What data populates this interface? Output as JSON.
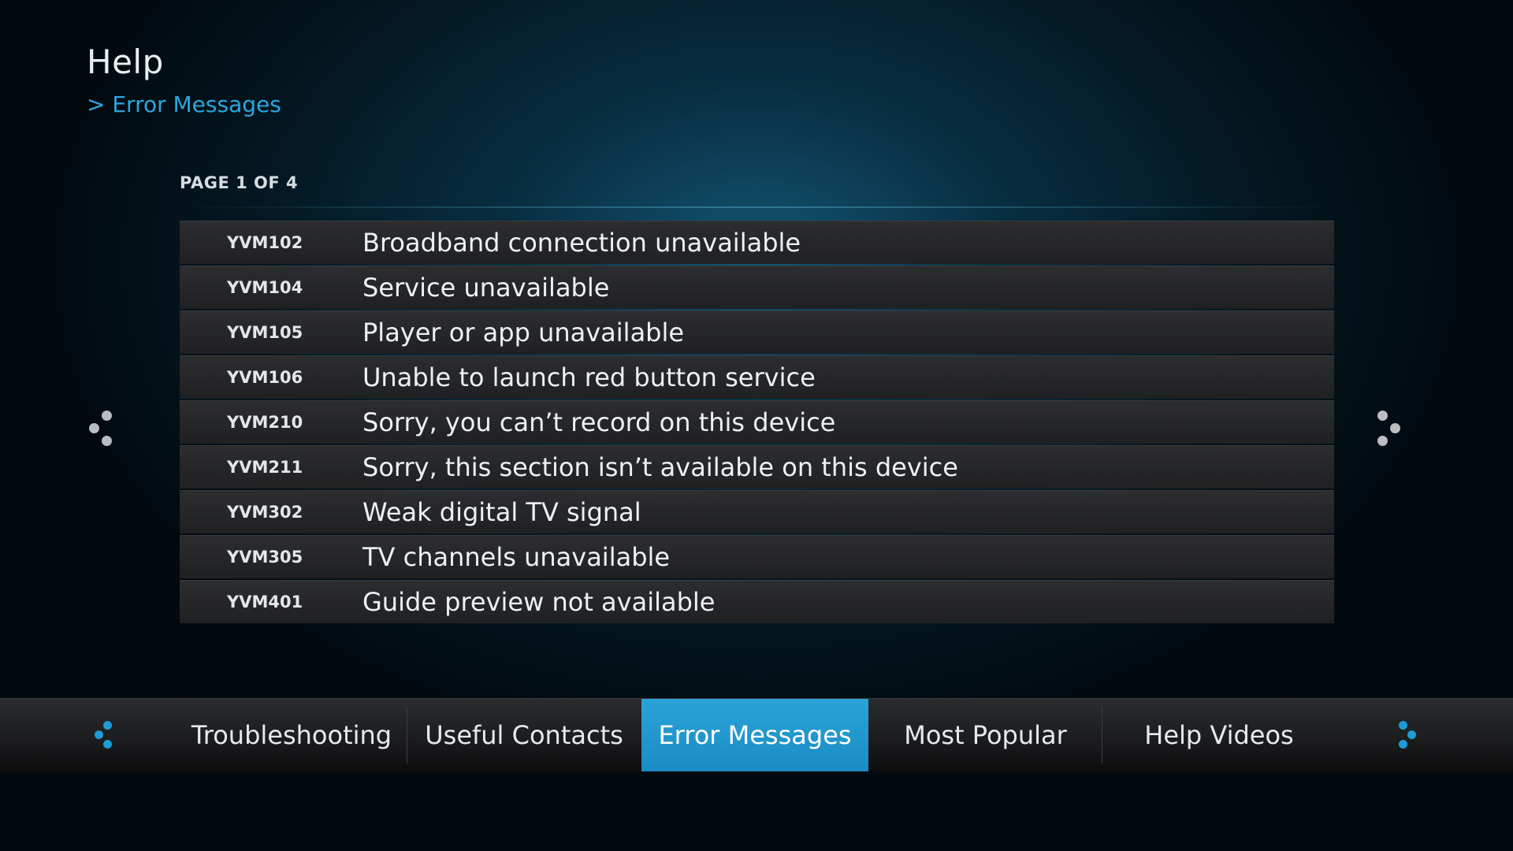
{
  "header": {
    "title": "Help",
    "breadcrumb": "> Error Messages"
  },
  "list": {
    "page_indicator": "PAGE 1 OF 4",
    "items": [
      {
        "code": "YVM102",
        "text": "Broadband connection unavailable"
      },
      {
        "code": "YVM104",
        "text": "Service unavailable"
      },
      {
        "code": "YVM105",
        "text": "Player or app unavailable"
      },
      {
        "code": "YVM106",
        "text": "Unable to launch red button service"
      },
      {
        "code": "YVM210",
        "text": "Sorry, you can’t record on this device"
      },
      {
        "code": "YVM211",
        "text": "Sorry, this section isn’t available on this device"
      },
      {
        "code": "YVM302",
        "text": "Weak digital TV signal"
      },
      {
        "code": "YVM305",
        "text": "TV channels unavailable"
      },
      {
        "code": "YVM401",
        "text": "Guide preview not available"
      }
    ]
  },
  "nav": {
    "tabs": [
      {
        "label": "Troubleshooting",
        "active": false
      },
      {
        "label": "Useful Contacts",
        "active": false
      },
      {
        "label": "Error Messages",
        "active": true
      },
      {
        "label": "Most Popular",
        "active": false
      },
      {
        "label": "Help Videos",
        "active": false
      }
    ]
  },
  "icons": {
    "list_prev": "page-prev-dots-icon",
    "list_next": "page-next-dots-icon",
    "nav_prev": "nav-prev-dots-icon",
    "nav_next": "nav-next-dots-icon"
  },
  "colors": {
    "accent": "#1e9bd6",
    "breadcrumb": "#29a8e0",
    "active_tab": "#1a8cc4"
  }
}
